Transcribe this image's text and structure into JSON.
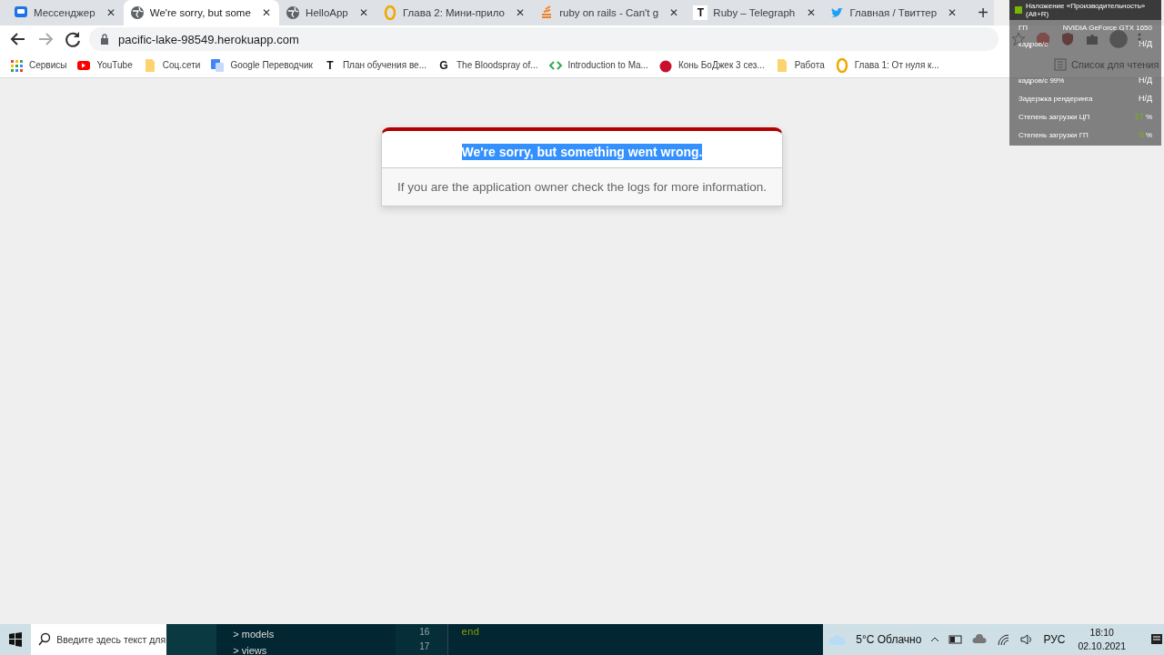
{
  "tabs": [
    {
      "title": "Мессенджер",
      "kind": "chat",
      "close": "✕",
      "selected": false
    },
    {
      "title": "We're sorry, but some",
      "kind": "globe",
      "close": "✕",
      "selected": true
    },
    {
      "title": "HelloApp",
      "kind": "globe",
      "close": "✕",
      "selected": false
    },
    {
      "title": "Глава 2: Мини-прило",
      "kind": "ring",
      "close": "✕",
      "selected": false
    },
    {
      "title": "ruby on rails - Can't g",
      "kind": "stack",
      "close": "✕",
      "selected": false
    },
    {
      "title": "Ruby – Telegraph",
      "kind": "letter",
      "icon_text": "T",
      "close": "✕",
      "selected": false
    },
    {
      "title": "Главная / Твиттер",
      "kind": "bird",
      "close": "✕",
      "selected": false
    }
  ],
  "new_tab": "+",
  "address": "pacific-lake-98549.herokuapp.com",
  "bookmarks": [
    {
      "label": "Сервисы",
      "kind": "grid"
    },
    {
      "label": "YouTube",
      "kind": "play"
    },
    {
      "label": "Соц.сети",
      "kind": "folder"
    },
    {
      "label": "Google Переводчик",
      "kind": "translate"
    },
    {
      "label": "План обучения ве...",
      "kind": "letter",
      "icon_text": "T"
    },
    {
      "label": "The Bloodspray of...",
      "kind": "letter",
      "icon_text": "G"
    },
    {
      "label": "Introduction to Ma...",
      "kind": "code"
    },
    {
      "label": "Конь БоДжек 3 сез...",
      "kind": "redball"
    },
    {
      "label": "Работа",
      "kind": "folder"
    },
    {
      "label": "Глава 1: От нуля к...",
      "kind": "ring"
    }
  ],
  "reading_list": "Список для чтения",
  "error": {
    "title": "We're sorry, but something went wrong.",
    "highlighted": true,
    "message": "If you are the application owner check the logs for more information."
  },
  "overlay": {
    "title": "Наложение «Производительность» (Alt+R)",
    "gpu_label": "ГП",
    "gpu_name": "NVIDIA GeForce GTX 1650",
    "rows": [
      {
        "label": "кадров/с",
        "value": "Н/Д",
        "kind": "text"
      },
      {
        "label": "кадров/с 99%",
        "value": "Н/Д",
        "kind": "text"
      },
      {
        "label": "Задержка рендеринга",
        "value": "Н/Д",
        "kind": "text"
      },
      {
        "label": "Степень загрузки ЦП",
        "value": "17",
        "unit": "%",
        "kind": "percent"
      },
      {
        "label": "Степень загрузки ГП",
        "value": "0",
        "unit": "%",
        "kind": "percent"
      }
    ]
  },
  "taskbar": {
    "search_placeholder": "Введите здесь текст для",
    "tree": [
      {
        "chevron": ">",
        "label": "models"
      },
      {
        "chevron": ">",
        "label": "views"
      }
    ],
    "line_numbers": [
      "16",
      "17"
    ],
    "code": [
      "end"
    ],
    "weather": "5°C Облачно",
    "language": "РУС",
    "time": "18:10",
    "date": "02.10.2021"
  }
}
